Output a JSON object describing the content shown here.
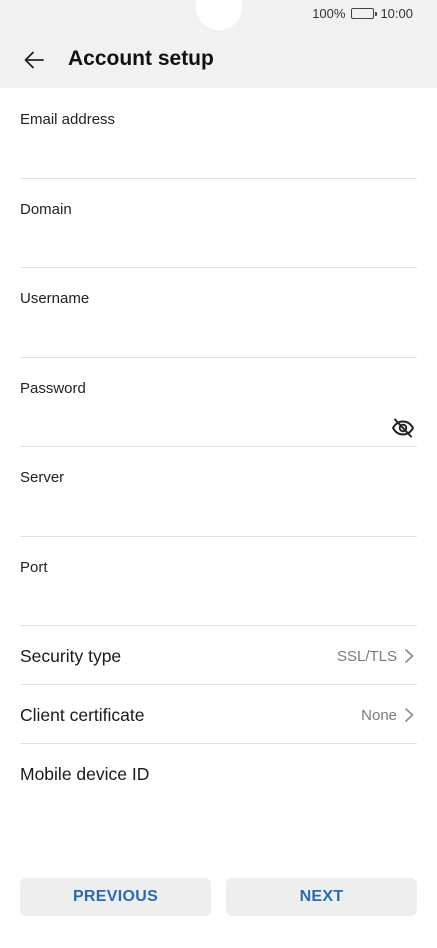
{
  "status_bar": {
    "battery_percent": "100%",
    "time": "10:00",
    "battery_level": 1.0
  },
  "header": {
    "back_icon": "arrow-left-icon",
    "title": "Account setup"
  },
  "form": {
    "email": {
      "label": "Email address",
      "value": ""
    },
    "domain": {
      "label": "Domain",
      "value": ""
    },
    "username": {
      "label": "Username",
      "value": ""
    },
    "password": {
      "label": "Password",
      "value": "",
      "toggle_icon": "eye-off-icon"
    },
    "server": {
      "label": "Server",
      "value": ""
    },
    "port": {
      "label": "Port",
      "value": ""
    }
  },
  "settings": {
    "security_type": {
      "label": "Security type",
      "value": "SSL/TLS"
    },
    "client_certificate": {
      "label": "Client certificate",
      "value": "None"
    },
    "mobile_device_id": {
      "label": "Mobile device ID"
    }
  },
  "buttons": {
    "previous": "PREVIOUS",
    "next": "NEXT"
  },
  "colors": {
    "header_bg": "#f1f1f1",
    "button_bg": "#eeeeee",
    "accent": "#2a6bb0",
    "divider": "#e3e3e3"
  }
}
